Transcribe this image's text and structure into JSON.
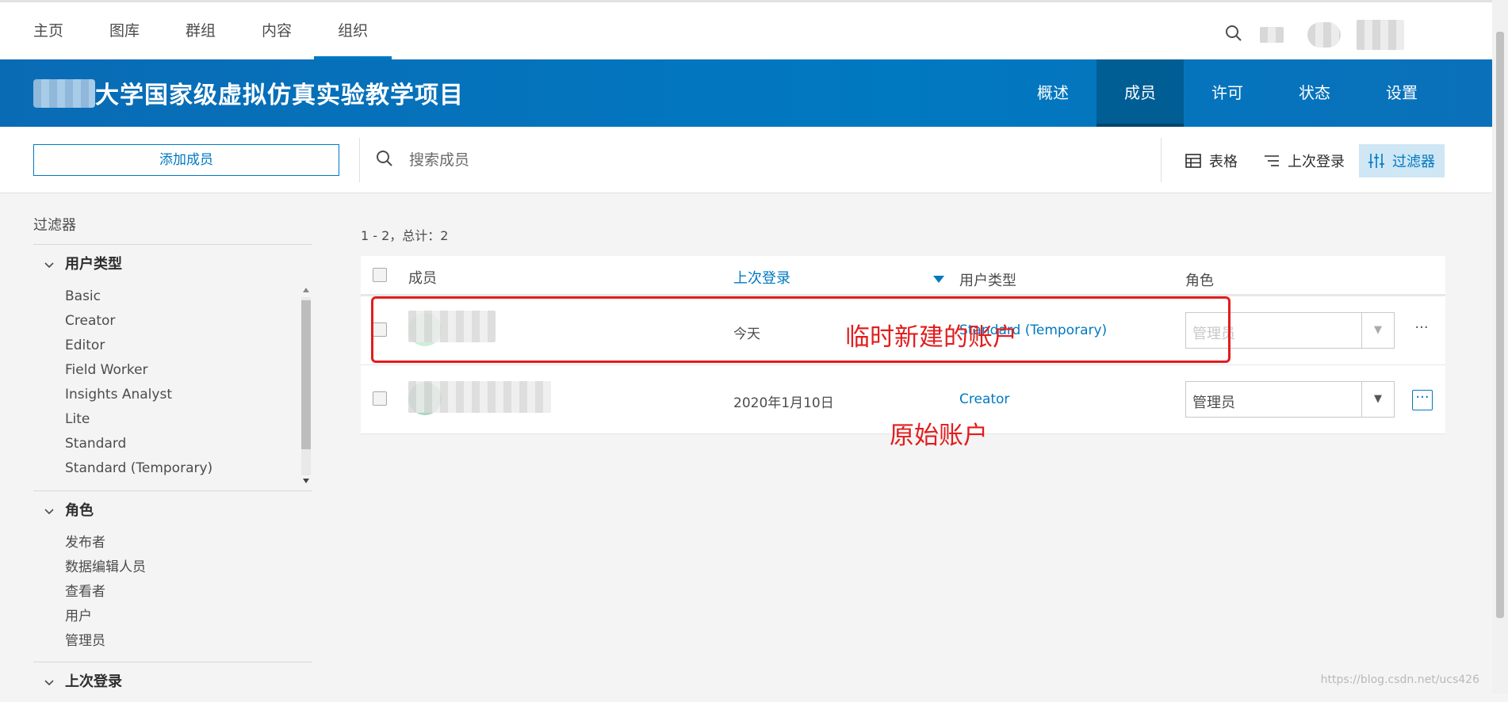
{
  "top_nav": {
    "items": [
      "主页",
      "图库",
      "群组",
      "内容",
      "组织"
    ],
    "active": "组织"
  },
  "banner": {
    "title": "大学国家级虚拟仿真实验教学项目",
    "tabs": [
      "概述",
      "成员",
      "许可",
      "状态",
      "设置"
    ],
    "active_tab": "成员"
  },
  "toolbar": {
    "add_member": "添加成员",
    "search_placeholder": "搜索成员",
    "table_view": "表格",
    "sort_last_login": "上次登录",
    "filter": "过滤器"
  },
  "sidebar": {
    "heading": "过滤器",
    "groups": [
      {
        "title": "用户类型",
        "items": [
          "Basic",
          "Creator",
          "Editor",
          "Field Worker",
          "Insights Analyst",
          "Lite",
          "Standard",
          "Standard (Temporary)"
        ]
      },
      {
        "title": "角色",
        "items": [
          "发布者",
          "数据编辑人员",
          "查看者",
          "用户",
          "管理员"
        ]
      }
    ],
    "next_group": "上次登录"
  },
  "results": {
    "count": "1 - 2，总计：2"
  },
  "table": {
    "headers": {
      "member": "成员",
      "last_login": "上次登录",
      "user_type": "用户类型",
      "role": "角色"
    },
    "rows": [
      {
        "last_login": "今天",
        "user_type": "Standard (Temporary)",
        "role": "管理员"
      },
      {
        "last_login": "2020年1月10日",
        "user_type": "Creator",
        "role": "管理员"
      }
    ]
  },
  "annotations": {
    "temp_account": "临时新建的账户",
    "original_account": "原始账户"
  },
  "watermark": "https://blog.csdn.net/ucs426",
  "colors": {
    "brand": "#0079c1",
    "annotation": "#e21d1d"
  }
}
